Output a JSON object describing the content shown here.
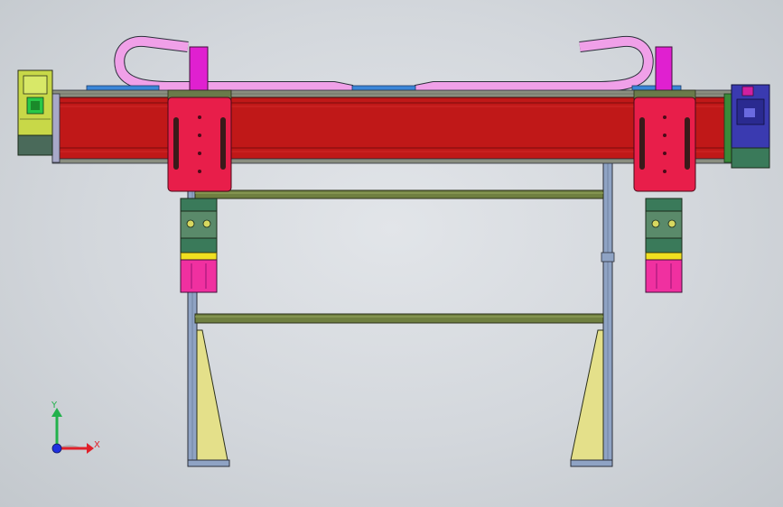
{
  "triad": {
    "x_label": "X",
    "y_label": "Y",
    "x_color": "#e0202a",
    "y_color": "#22b14c",
    "z_color": "#2030e0"
  },
  "colors": {
    "background": "#d3d7dc",
    "rail_body": "#c01818",
    "carriage_plate": "#e81e4a",
    "cable_chain": "#f0a0e8",
    "bracket": "#e020d0",
    "frame": "#8a9fc0",
    "crossbar": "#6f7f40",
    "leg_gusset": "#e4e08a",
    "motor_left": "#c8d848",
    "motor_right": "#3a3ab0",
    "gripper_base": "#3a7a5a",
    "gripper_magenta": "#f030a0",
    "gripper_yellow": "#f0e020",
    "top_strip": "#3a86d8"
  }
}
